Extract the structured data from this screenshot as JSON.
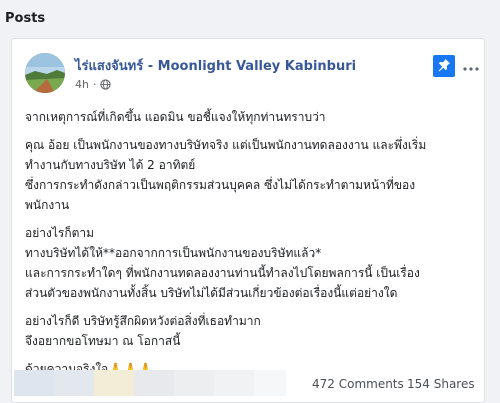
{
  "section": {
    "title": "Posts"
  },
  "post": {
    "page_name": "ไร่แสงจันทร์ - Moonlight Valley Kabinburi",
    "time": "4h",
    "separator": "·",
    "paragraphs": [
      [
        "จากเหตุการณ์ที่เกิดขึ้น แอดมิน ขอชี้แจงให้ทุกท่านทราบว่า"
      ],
      [
        "คุณ อ้อย เป็นพนักงานของทางบริษัทจริง แต่เป็นพนักงานทดลองงาน และพึ่งเริ่ม",
        "ทำงานกับทางบริษัท ได้ 2 อาทิตย์",
        "ซึ่งการกระทำดังกล่าวเป็นพฤติกรรมส่วนบุคคล ซึ่งไม่ได้กระทำตามหน้าที่ของ",
        "พนักงาน"
      ],
      [
        "อย่างไรก็ตาม",
        "ทางบริษัทได้ให้**ออกจากการเป็นพนักงานของบริษัทแล้ว*",
        "และการกระทำใดๆ ที่พนักงานทดลองงานท่านนี้ทำลงไปโดยพลการนี้ เป็นเรื่อง",
        "ส่วนตัวของพนักงานทั้งสิ้น บริษัทไม่ได้มีส่วนเกี่ยวข้องต่อเรื่องนี้แต่อย่างใด"
      ],
      [
        "อย่างไรก็ดี บริษัทรู้สึกผิดหวังต่อสิ่งที่เธอทำมาก",
        "จึงอยากขอโทษมา ณ โอกาสนี้"
      ],
      [
        "ด้วยความจริงใจ🙏🙏🙏"
      ]
    ],
    "comments": "472 Comments",
    "shares": "154 Shares",
    "icons": {
      "pin": "pin-icon",
      "more": "more-options-icon",
      "audience": "globe-icon"
    },
    "colors": {
      "page_name": "#385898",
      "pin_bg": "#1877f2",
      "text": "#1c1e21",
      "muted": "#65676b"
    }
  }
}
